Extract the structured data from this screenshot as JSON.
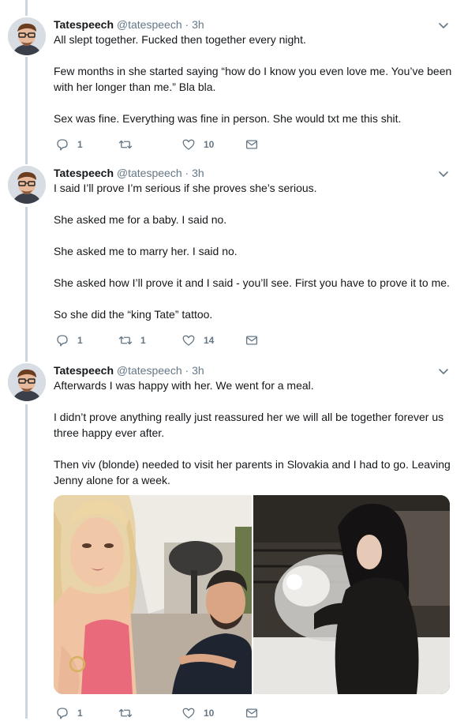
{
  "tweets": [
    {
      "name": "Tatespeech",
      "handle": "@tatespeech",
      "dot": "·",
      "time": "3h",
      "paragraphs": [
        "All slept together. Fucked then together every night.",
        "Few months in she started saying “how do I know you even love me. You’ve been with her longer than me.” Bla bla.",
        "Sex was fine. Everything was fine in person. She would txt me this shit."
      ],
      "replies": "1",
      "retweets": "",
      "likes": "10"
    },
    {
      "name": "Tatespeech",
      "handle": "@tatespeech",
      "dot": "·",
      "time": "3h",
      "paragraphs": [
        "I said I’ll prove I’m serious if she proves she’s serious.",
        "She asked me for a baby. I said no.",
        "She asked me to marry her. I said no.",
        "She asked how I’ll prove it and I said - you’ll see. First you have to prove it to me.",
        "So she did the “king Tate” tattoo."
      ],
      "replies": "1",
      "retweets": "1",
      "likes": "14"
    },
    {
      "name": "Tatespeech",
      "handle": "@tatespeech",
      "dot": "·",
      "time": "3h",
      "paragraphs": [
        "Afterwards I was happy with her.  We went for a meal.",
        "I didn’t prove anything really just reassured her we will all be together forever us three happy ever after.",
        "Then viv (blonde) needed to visit her parents in Slovakia and I had to go. Leaving Jenny alone for a week."
      ],
      "replies": "1",
      "retweets": "",
      "likes": "10"
    }
  ],
  "icons": {
    "reply": "reply-icon",
    "retweet": "retweet-icon",
    "like": "heart-icon",
    "dm": "envelope-icon",
    "more": "chevron-down-icon"
  },
  "colors": {
    "text": "#14171a",
    "muted": "#657786",
    "thread_line": "#ccd6dd"
  }
}
